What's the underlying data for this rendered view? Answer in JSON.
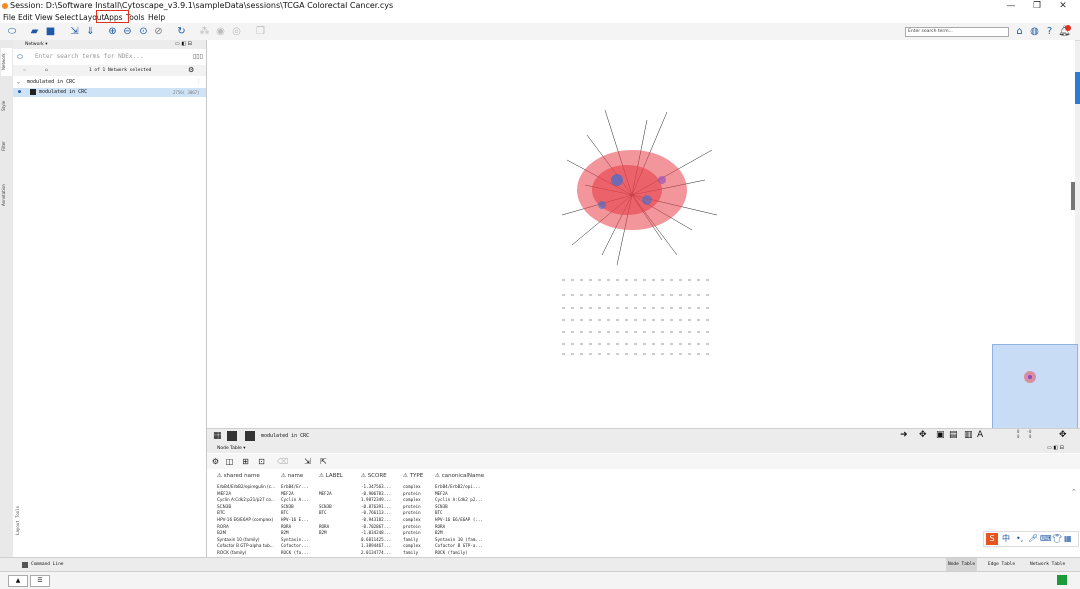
{
  "window": {
    "title": "Session: D:\\Software Install\\Cytoscape_v3.9.1\\sampleData\\sessions\\TCGA Colorectal Cancer.cys",
    "minimize": "—",
    "maximize": "❐",
    "close": "✕"
  },
  "menu": [
    "File",
    "Edit",
    "View",
    "Select",
    "Layout",
    "Apps",
    "Tools",
    "Help"
  ],
  "toolbar": {
    "search_placeholder": "Enter search term..."
  },
  "left_tabs": [
    "Network",
    "Style",
    "Filter",
    "Annotation"
  ],
  "control_panel": {
    "header": "Network ▾",
    "search_placeholder": "Enter search terms for NDEx...",
    "selection_info": "1 of 1 Network selected",
    "collection_name": "modulated in CRC",
    "network_name": "modulated in CRC",
    "network_counts": "2756(  3867)"
  },
  "network_view": {
    "title": "modulated in CRC",
    "zoom_readout": "0   -0\n0    0"
  },
  "table_panel": {
    "header": "Node Table ▾",
    "columns": [
      "shared name",
      "name",
      "LABEL",
      "SCORE",
      "TYPE",
      "canonicalName"
    ],
    "rows": [
      [
        "ErbB4/ErbB2/epiregulin (c...",
        "ErbB4/Er...",
        "",
        "-1.347563...",
        "complex",
        "ErbB4/ErbB2/epi..."
      ],
      [
        "MEF2A",
        "MEF2A",
        "MEF2A",
        "-0.906783...",
        "protein",
        "MEF2A"
      ],
      [
        "Cyclin A:Cdk2:p21/p27 co...",
        "Cyclin A...",
        "",
        "1.9872349...",
        "complex",
        "Cyclin A:Cdk2 p2..."
      ],
      [
        "SCN3B",
        "SCN3B",
        "SCN3B",
        "-0.876391...",
        "protein",
        "SCN3B"
      ],
      [
        "BTC",
        "BTC",
        "BTC",
        "-0.766113...",
        "protein",
        "BTC"
      ],
      [
        "HPV-16 E6/E6AP (complex)",
        "HPV-16 E...",
        "",
        "-0.943182...",
        "complex",
        "HPV-16 E6/E6AP (..."
      ],
      [
        "RORA",
        "RORA",
        "RORA",
        "-0.702867...",
        "protein",
        "RORA"
      ],
      [
        "B2M",
        "B2M",
        "B2M",
        "-1.034248...",
        "protein",
        "B2M"
      ],
      [
        "Syntaxin 10 (family)",
        "Syntaxin...",
        "",
        "0.6811425...",
        "family",
        "Syntaxin 10 (fam..."
      ],
      [
        "Cofactor B GTP-alpha tub...",
        "Cofactor...",
        "",
        "1.3894467...",
        "complex",
        "Cofactor B GTP-a..."
      ],
      [
        "ROCK (family)",
        "ROCK (fa...",
        "",
        "2.0134774...",
        "family",
        "ROCK (family)"
      ]
    ]
  },
  "status": {
    "command_line": "Command Line",
    "node_table": "Node Table",
    "edge_table": "Edge Table",
    "network_table": "Network Table",
    "table_panel_tab": "Table Panel"
  },
  "colors": {
    "accent_blue": "#1f5aa6",
    "annotation_red": "#e0301e",
    "node_red": "#e8404a",
    "node_blue": "#3b6fd4",
    "selection_row": "#cfe3f7"
  }
}
